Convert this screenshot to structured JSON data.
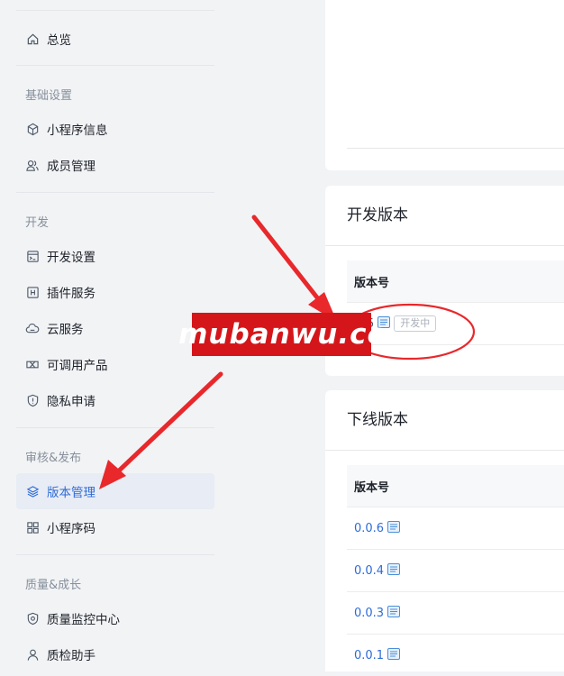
{
  "sidebar": {
    "overview": {
      "label": "总览",
      "icon": "home-icon"
    },
    "sections": [
      {
        "title": "基础设置",
        "items": [
          {
            "label": "小程序信息",
            "icon": "cube-icon"
          },
          {
            "label": "成员管理",
            "icon": "users-icon"
          }
        ]
      },
      {
        "title": "开发",
        "items": [
          {
            "label": "开发设置",
            "icon": "dev-settings-icon"
          },
          {
            "label": "插件服务",
            "icon": "plugin-icon"
          },
          {
            "label": "云服务",
            "icon": "cloud-icon"
          },
          {
            "label": "可调用产品",
            "icon": "product-icon"
          },
          {
            "label": "隐私申请",
            "icon": "privacy-shield-icon"
          }
        ]
      },
      {
        "title": "审核&发布",
        "items": [
          {
            "label": "版本管理",
            "icon": "layers-icon",
            "active": true
          },
          {
            "label": "小程序码",
            "icon": "qrcode-icon"
          }
        ]
      },
      {
        "title": "质量&成长",
        "items": [
          {
            "label": "质量监控中心",
            "icon": "monitor-shield-icon"
          },
          {
            "label": "质检助手",
            "icon": "person-icon"
          }
        ]
      }
    ]
  },
  "dev_version": {
    "title": "开发版本",
    "column": "版本号",
    "version_partial": "5",
    "status": "开发中"
  },
  "offline_version": {
    "title": "下线版本",
    "column": "版本号",
    "versions": [
      "0.0.6",
      "0.0.4",
      "0.0.3",
      "0.0.1"
    ]
  },
  "watermark": {
    "text": "mubanwu.cc"
  },
  "colors": {
    "accent": "#2e6bd8",
    "active_bg": "#e8ecf4",
    "annotation_red": "#e8282b"
  }
}
